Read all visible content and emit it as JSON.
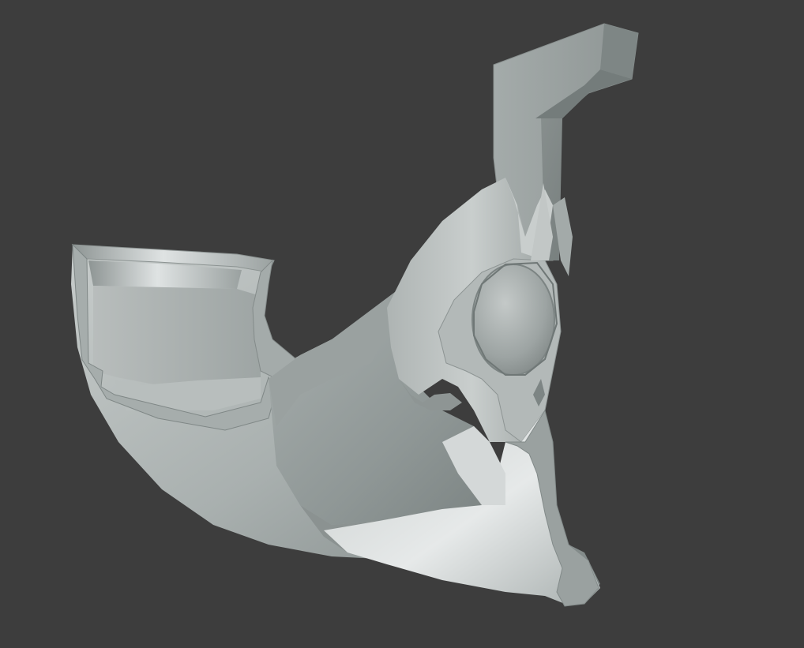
{
  "viewport": {
    "background_color": "#3d3d3d",
    "shading": "solid"
  },
  "model": {
    "material_color": "#b4b9b8",
    "highlight_color": "#e2e6e6",
    "shadow_color": "#7d8483"
  }
}
